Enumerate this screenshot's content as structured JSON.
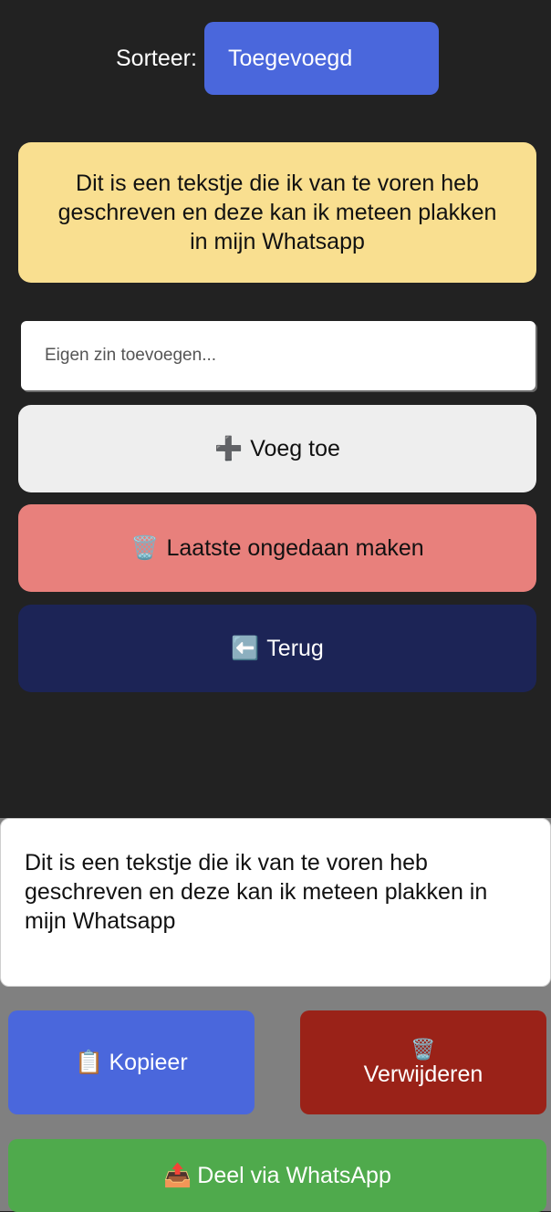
{
  "sort": {
    "label": "Sorteer:",
    "selected": "Toegevoegd"
  },
  "phrase_card": {
    "text": "Dit is een tekstje die ik van te voren heb geschreven en deze kan ik meteen plakken in mijn Whatsapp"
  },
  "add_input": {
    "placeholder": "Eigen zin toevoegen...",
    "value": ""
  },
  "buttons": {
    "add": {
      "icon": "➕",
      "label": "Voeg toe"
    },
    "undo": {
      "icon": "🗑️",
      "label": "Laatste ongedaan maken"
    },
    "back": {
      "icon": "⬅️",
      "label": "Terug"
    }
  },
  "preview": {
    "text": "Dit is een tekstje die ik van te voren heb geschreven en deze kan ik meteen plakken in mijn Whatsapp"
  },
  "actions": {
    "copy": {
      "icon": "📋",
      "label": "Kopieer"
    },
    "delete": {
      "icon": "🗑️",
      "label": "Verwijderen"
    },
    "share": {
      "icon": "📤",
      "label": "Deel via WhatsApp"
    }
  },
  "colors": {
    "background": "#222222",
    "accent_blue": "#4a67dc",
    "card_yellow": "#f9df90",
    "undo_red": "#e8807c",
    "back_navy": "#1c2456",
    "delete_red": "#9a2218",
    "share_green": "#4faa4c"
  }
}
